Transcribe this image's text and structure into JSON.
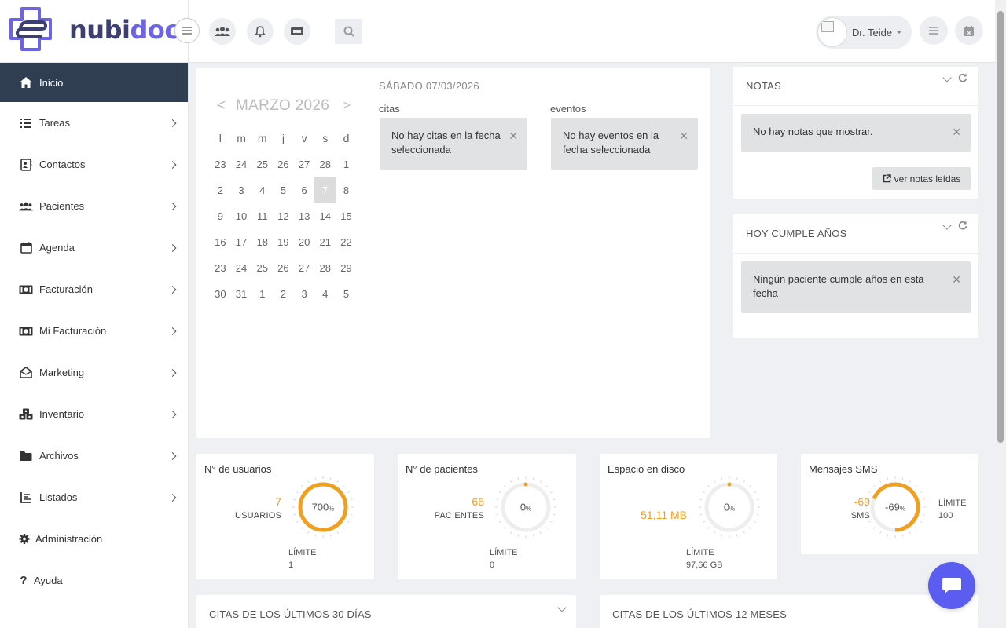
{
  "brand": {
    "part1": "nubi",
    "part2": "doc"
  },
  "header": {
    "user_name": "Dr. Teide"
  },
  "sidebar": {
    "items": [
      {
        "label": "Inicio",
        "icon": "home-icon"
      },
      {
        "label": "Tareas",
        "icon": "list-icon"
      },
      {
        "label": "Contactos",
        "icon": "contact-card-icon"
      },
      {
        "label": "Pacientes",
        "icon": "users-icon"
      },
      {
        "label": "Agenda",
        "icon": "calendar-icon"
      },
      {
        "label": "Facturación",
        "icon": "money-icon"
      },
      {
        "label": "Mi Facturación",
        "icon": "money-icon"
      },
      {
        "label": "Marketing",
        "icon": "envelope-open-icon"
      },
      {
        "label": "Inventario",
        "icon": "cubes-icon"
      },
      {
        "label": "Archivos",
        "icon": "folder-icon"
      },
      {
        "label": "Listados",
        "icon": "chart-list-icon"
      },
      {
        "label": "Administración",
        "icon": "gear-icon"
      },
      {
        "label": "Ayuda",
        "icon": "question-icon"
      }
    ]
  },
  "calendar": {
    "prev": "<",
    "next": ">",
    "month_title": "MARZO 2026",
    "weekdays": [
      "l",
      "m",
      "m",
      "j",
      "v",
      "s",
      "d"
    ],
    "weeks": [
      [
        "23",
        "24",
        "25",
        "26",
        "27",
        "28",
        "1"
      ],
      [
        "2",
        "3",
        "4",
        "5",
        "6",
        "7",
        "8"
      ],
      [
        "9",
        "10",
        "11",
        "12",
        "13",
        "14",
        "15"
      ],
      [
        "16",
        "17",
        "18",
        "19",
        "20",
        "21",
        "22"
      ],
      [
        "23",
        "24",
        "25",
        "26",
        "27",
        "28",
        "29"
      ],
      [
        "30",
        "31",
        "1",
        "2",
        "3",
        "4",
        "5"
      ]
    ],
    "selected_day": "7",
    "date_label": "SÁBADO 07/03/2026",
    "citas_label": "citas",
    "citas_msg": "No hay citas en la fecha seleccionada",
    "eventos_label": "eventos",
    "eventos_msg": "No hay eventos en la fecha seleccionada"
  },
  "notas": {
    "title": "NOTAS",
    "msg": "No hay notas que mostrar.",
    "button": "ver notas leídas"
  },
  "cumple": {
    "title": "HOY CUMPLE AÑOS",
    "msg": "Ningún paciente cumple años en esta fecha"
  },
  "stats": {
    "usuarios": {
      "title": "N° de usuarios",
      "value": "7",
      "unit": "USUARIOS",
      "pct": 700,
      "pct_label": "700",
      "limit_label": "LÍMITE",
      "limit_value": "1"
    },
    "pacientes": {
      "title": "N° de pacientes",
      "value": "66",
      "unit": "PACIENTES",
      "pct": 0,
      "pct_label": "0",
      "limit_label": "LÍMITE",
      "limit_value": "0"
    },
    "disco": {
      "title": "Espacio en disco",
      "value": "51,11 MB",
      "pct": 0,
      "pct_label": "0",
      "limit_label": "LÍMITE",
      "limit_value": "97,66 GB"
    },
    "sms": {
      "title": "Mensajes SMS",
      "value": "-69",
      "unit": "SMS",
      "pct": -69,
      "pct_label": "-69",
      "limit_label": "LÍMITE",
      "limit_value": "100"
    }
  },
  "bottom": {
    "citas30": "CITAS DE LOS ÚLTIMOS 30 DÍAS",
    "citas12": "CITAS DE LOS ÚLTIMOS 12 MESES"
  },
  "colors": {
    "accent": "#f0a020",
    "brand": "#6c63e6",
    "brand_dark": "#3c3f73",
    "sidebar_active": "#2f3e50",
    "chat": "#5b5cf0"
  }
}
